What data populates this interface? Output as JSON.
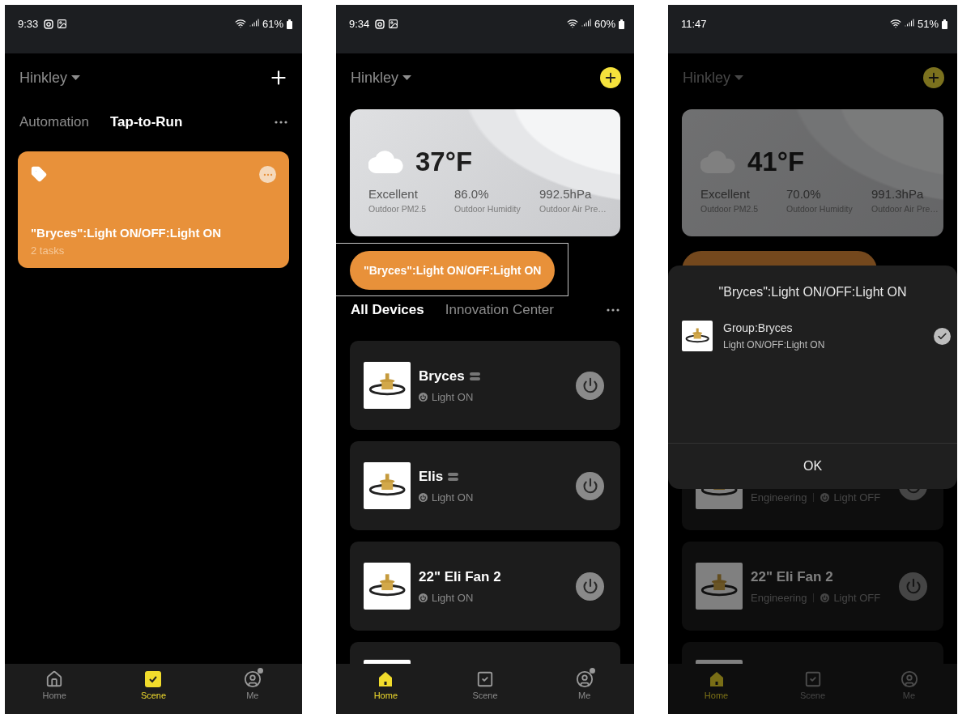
{
  "screens": [
    {
      "kind": "scenes",
      "status_bar": {
        "time": "9:33",
        "app_notifications": true,
        "battery": "61%"
      },
      "home_selector": "Hinkley",
      "tabs": [
        {
          "label": "Automation",
          "selected": false
        },
        {
          "label": "Tap-to-Run",
          "selected": true
        }
      ],
      "scene_cards": [
        {
          "title": "\"Bryces\":Light ON/OFF:Light ON",
          "subtitle": "2 tasks"
        }
      ],
      "nav": [
        {
          "label": "Home",
          "kind": "home",
          "selected": false,
          "badge": false
        },
        {
          "label": "Scene",
          "kind": "scene",
          "selected": true,
          "badge": false
        },
        {
          "label": "Me",
          "kind": "me",
          "selected": false,
          "badge": true
        }
      ]
    },
    {
      "kind": "devices",
      "dimmed": false,
      "status_bar": {
        "time": "9:34",
        "app_notifications": true,
        "battery": "60%"
      },
      "home_selector": "Hinkley",
      "weather": {
        "temperature": "37°F",
        "stats": [
          {
            "value": "Excellent",
            "label": "Outdoor PM2.5"
          },
          {
            "value": "86.0%",
            "label": "Outdoor Humidity"
          },
          {
            "value": "992.5hPa",
            "label": "Outdoor Air Pre…"
          }
        ]
      },
      "scene_pill": {
        "label": "\"Bryces\":Light ON/OFF:Light ON",
        "highlighted": true
      },
      "tabs": [
        {
          "label": "All Devices",
          "selected": true
        },
        {
          "label": "Innovation Center",
          "selected": false
        }
      ],
      "devices": [
        {
          "name": "Bryces",
          "group": true,
          "status": "Light ON"
        },
        {
          "name": "Elis",
          "group": true,
          "status": "Light ON"
        },
        {
          "name": "22\" Eli Fan 2",
          "group": false,
          "status": "Light ON"
        }
      ],
      "nav": [
        {
          "label": "Home",
          "kind": "home",
          "selected": true,
          "badge": false
        },
        {
          "label": "Scene",
          "kind": "scene",
          "selected": false,
          "badge": false
        },
        {
          "label": "Me",
          "kind": "me",
          "selected": false,
          "badge": true
        }
      ]
    },
    {
      "kind": "devices",
      "dimmed": true,
      "status_bar": {
        "time": "11:47",
        "app_notifications": false,
        "battery": "51%"
      },
      "home_selector": "Hinkley",
      "weather": {
        "temperature": "41°F",
        "stats": [
          {
            "value": "Excellent",
            "label": "Outdoor PM2.5"
          },
          {
            "value": "70.0%",
            "label": "Outdoor Humidity"
          },
          {
            "value": "991.3hPa",
            "label": "Outdoor Air Pre…"
          }
        ]
      },
      "scene_pill": {
        "highlighted": false
      },
      "devices": [
        {
          "room": "Engineering",
          "group": false,
          "status": "Light OFF"
        },
        {
          "name": "22\" Eli Fan 2",
          "room": "Engineering",
          "group": false,
          "status": "Light OFF"
        }
      ],
      "dialog": {
        "title": "\"Bryces\":Light ON/OFF:Light ON",
        "items": [
          {
            "name": "Group:Bryces",
            "action": "Light ON/OFF:Light ON",
            "checked": true
          }
        ],
        "button": "OK"
      },
      "nav": [
        {
          "label": "Home",
          "kind": "home",
          "selected": true,
          "badge": false
        },
        {
          "label": "Scene",
          "kind": "scene",
          "selected": false,
          "badge": false
        },
        {
          "label": "Me",
          "kind": "me",
          "selected": false,
          "badge": false
        }
      ]
    }
  ]
}
